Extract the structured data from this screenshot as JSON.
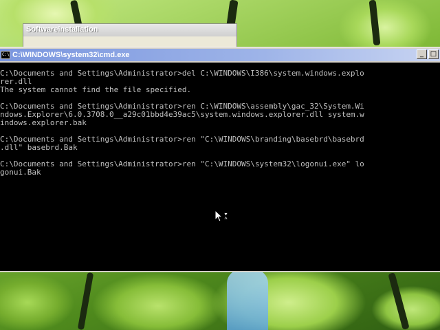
{
  "background_window": {
    "title": "Softwareinstallation"
  },
  "cmd_window": {
    "title": "C:\\WINDOWS\\system32\\cmd.exe",
    "icon_glyph": "C:\\",
    "minimize_glyph": "_",
    "maximize_glyph": "□",
    "console_lines": [
      "C:\\Documents and Settings\\Administrator>del C:\\WINDOWS\\I386\\system.windows.explo",
      "rer.dll",
      "The system cannot find the file specified.",
      "",
      "C:\\Documents and Settings\\Administrator>ren C:\\WINDOWS\\assembly\\gac_32\\System.Wi",
      "ndows.Explorer\\6.0.3708.0__a29c01bbd4e39ac5\\system.windows.explorer.dll system.w",
      "indows.explorer.bak",
      "",
      "C:\\Documents and Settings\\Administrator>ren \"C:\\WINDOWS\\branding\\basebrd\\basebrd",
      ".dll\" basebrd.Bak",
      "",
      "C:\\Documents and Settings\\Administrator>ren \"C:\\WINDOWS\\system32\\logonui.exe\" lo",
      "gonui.Bak"
    ]
  },
  "cursor": {
    "icon": "arrow-hourglass-busy-cursor"
  },
  "colors": {
    "console_background": "#000000",
    "console_text": "#c0c0c0",
    "titlebar_inactive": "#7a96df"
  }
}
